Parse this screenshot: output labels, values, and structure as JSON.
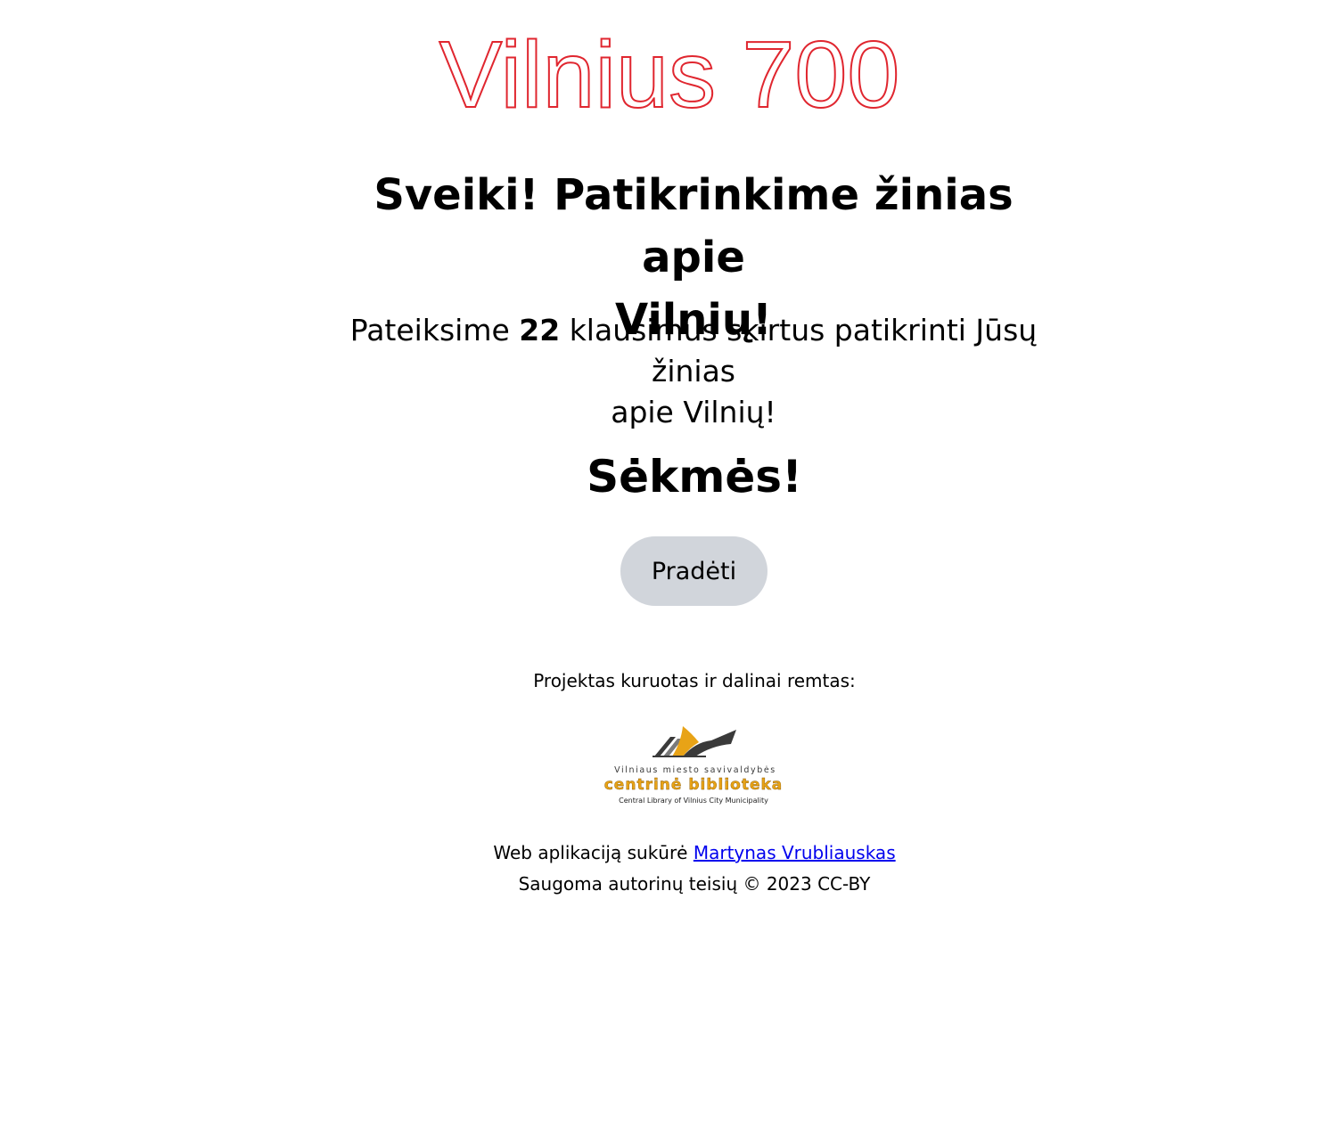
{
  "header": {
    "logo_text": "Vilnius 700",
    "logo_color": "#e0262f"
  },
  "welcome": {
    "heading_line1": "Sveiki! Patikrinkime žinias apie",
    "heading_line2": "Vilnių!",
    "intro_prefix": "Pateiksime ",
    "question_count": "22",
    "intro_suffix_line1": " klausimus skirtus patikrinti Jūsų žinias",
    "intro_line2": "apie Vilnių!",
    "luck_text": "Sėkmės!"
  },
  "actions": {
    "start_label": "Pradėti",
    "start_button_color": "#d1d5db"
  },
  "sponsor": {
    "label": "Projektas kuruotas ir dalinai remtas:",
    "logo_top_text": "Vilniaus miesto savivaldybės",
    "logo_main_text": "centrinė biblioteka",
    "logo_sub_text": "Central Library of Vilnius City Municipality",
    "logo_accent_color": "#e8a317",
    "logo_dark_color": "#3a3a3a"
  },
  "footer": {
    "made_by_prefix": "Web aplikaciją sukūrė ",
    "author_name": "Martynas Vrubliauskas",
    "copyright": "Saugoma autorinų teisių © 2023 CC-BY",
    "link_color": "#0000ee"
  }
}
